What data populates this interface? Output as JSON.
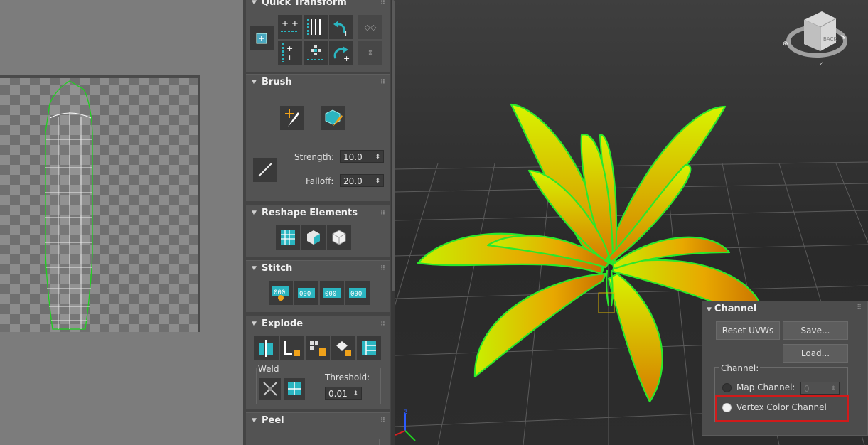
{
  "uv_editor": {},
  "panel": {
    "quick_transform": {
      "title": "Quick Transform"
    },
    "brush": {
      "title": "Brush",
      "strength_label": "Strength:",
      "strength_value": "10.0",
      "falloff_label": "Falloff:",
      "falloff_value": "20.0"
    },
    "reshape": {
      "title": "Reshape Elements"
    },
    "stitch": {
      "title": "Stitch"
    },
    "explode": {
      "title": "Explode",
      "weld_label": "Weld",
      "threshold_label": "Threshold:",
      "threshold_value": "0.01"
    },
    "peel": {
      "title": "Peel"
    }
  },
  "viewcube": {
    "face_label": "BACK"
  },
  "channel": {
    "title": "Channel",
    "reset_label": "Reset UVWs",
    "save_label": "Save...",
    "load_label": "Load...",
    "group_label": "Channel:",
    "map_channel_label": "Map Channel:",
    "map_channel_value": "0",
    "vertex_color_label": "Vertex Color Channel",
    "selected": "vertex_color"
  },
  "colors": {
    "accent_teal": "#2bb5c0",
    "accent_orange": "#f0a21a",
    "uv_edge": "#20d020",
    "highlight_red": "#d11a1a"
  },
  "icons": [
    "zoom-region-icon",
    "align-horizontal-icon",
    "align-vertical-icon",
    "rotate-ccw-icon",
    "rotate-cw-icon",
    "align-center-icon",
    "move-brush-icon",
    "relax-brush-icon",
    "line-tool-icon",
    "straighten-icon",
    "relax-icon",
    "relax-cube-icon",
    "stitch-icon",
    "break-icon",
    "weld-icon"
  ]
}
